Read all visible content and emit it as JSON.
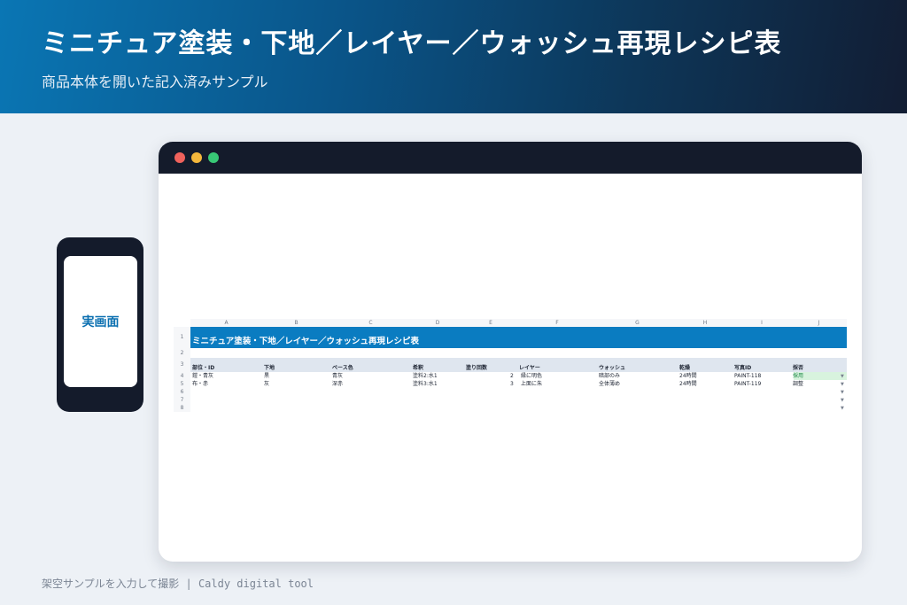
{
  "header": {
    "title": "ミニチュア塗装・下地／レイヤー／ウォッシュ再現レシピ表",
    "subtitle": "商品本体を開いた記入済みサンプル"
  },
  "phone": {
    "label": "実画面"
  },
  "sheet": {
    "columns": [
      "A",
      "B",
      "C",
      "D",
      "E",
      "F",
      "G",
      "H",
      "I",
      "J"
    ],
    "rows": [
      "1",
      "2",
      "3",
      "4",
      "5",
      "6",
      "7",
      "8"
    ],
    "banner": "ミニチュア塗装・下地／レイヤー／ウォッシュ再現レシピ表",
    "headers": [
      "部位・ID",
      "下地",
      "ベース色",
      "希釈",
      "塗り回数",
      "レイヤー",
      "ウォッシュ",
      "乾燥",
      "写真ID",
      "採否"
    ],
    "data_rows": [
      [
        "鎧・青灰",
        "黒",
        "青灰",
        "塗料2:水1",
        "2",
        "縁に明色",
        "暗部のみ",
        "24時間",
        "PAINT-118",
        "採用"
      ],
      [
        "布・赤",
        "灰",
        "深赤",
        "塗料3:水1",
        "3",
        "上面に朱",
        "全体薄め",
        "24時間",
        "PAINT-119",
        "調整"
      ]
    ]
  },
  "footer": "架空サンプルを入力して撮影 | Caldy digital tool",
  "colors": {
    "accent": "#0a7cc1",
    "header_dark": "#121d33",
    "adopt_green": "#d8f3de"
  }
}
